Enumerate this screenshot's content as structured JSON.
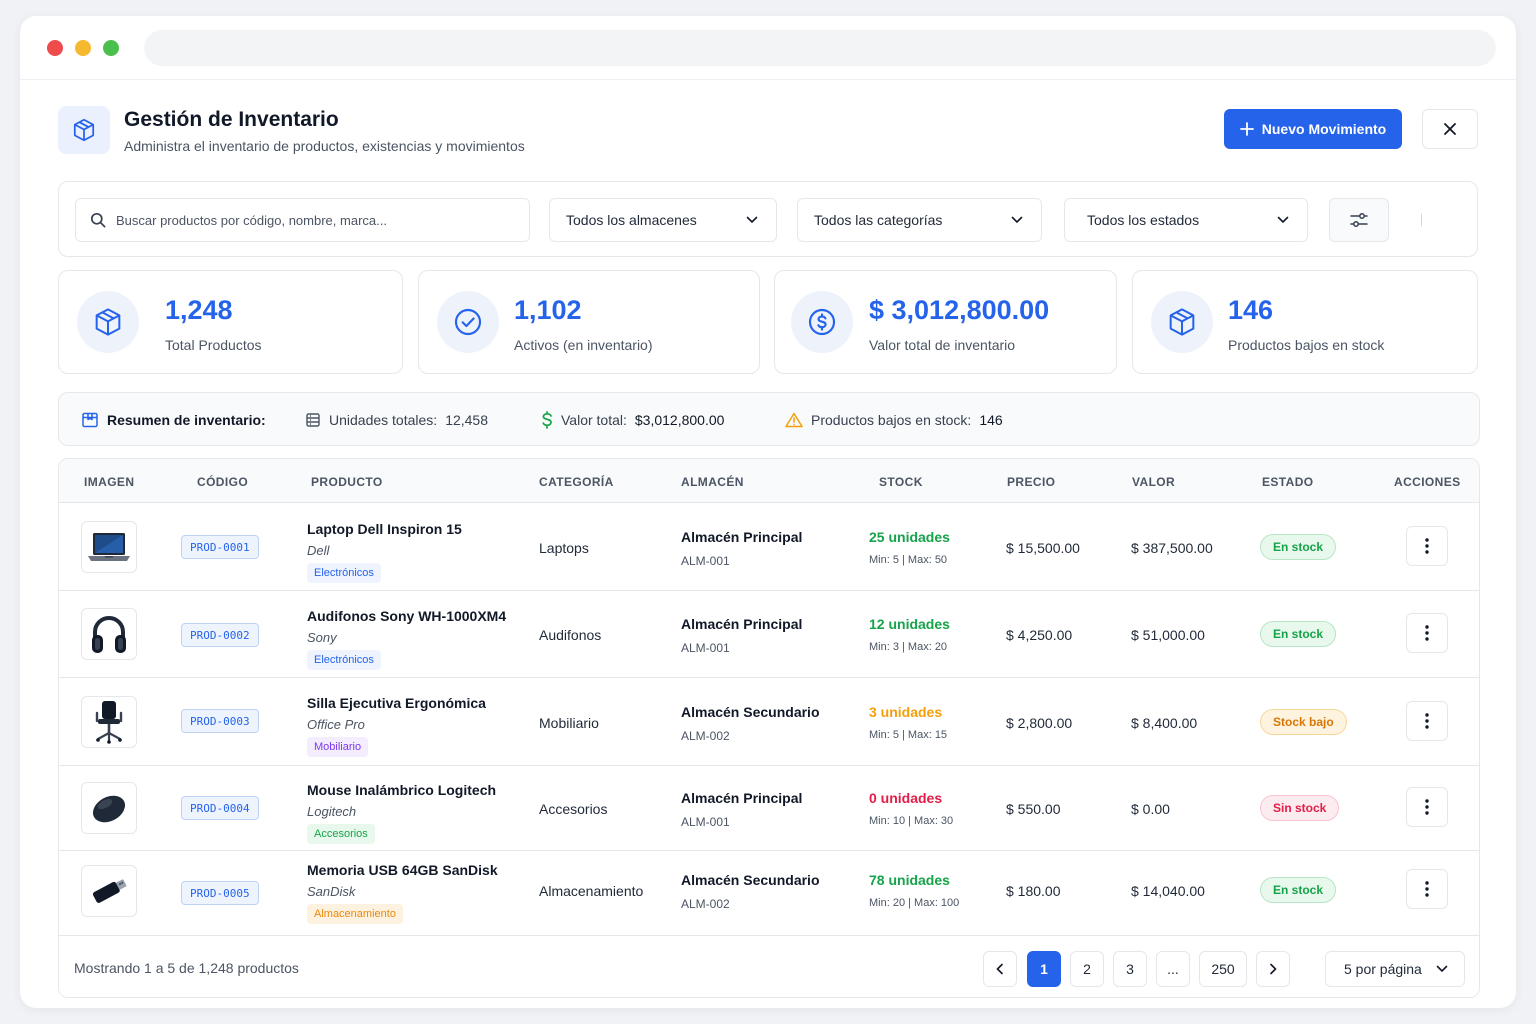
{
  "header": {
    "title": "Gestión de Inventario",
    "subtitle": "Administra el inventario de productos, existencias y movimientos",
    "new_button": "Nuevo Movimiento"
  },
  "filters": {
    "search_placeholder": "Buscar productos por código, nombre, marca...",
    "warehouse": "Todos los almacenes",
    "category": "Todos las categorías",
    "status": "Todos los estados"
  },
  "stats": [
    {
      "value": "1,248",
      "label": "Total Productos",
      "icon": "box-icon"
    },
    {
      "value": "1,102",
      "label": "Activos (en inventario)",
      "icon": "check-circle-icon"
    },
    {
      "value": "$ 3,012,800.00",
      "label": "Valor total de inventario",
      "icon": "dollar-circle-icon"
    },
    {
      "value": "146",
      "label": "Productos bajos en stock",
      "icon": "box-icon"
    }
  ],
  "summary": {
    "title": "Resumen de inventario:",
    "units_label": "Unidades totales:",
    "units_value": "12,458",
    "value_label": "Valor total:",
    "value_value": "$3,012,800.00",
    "low_label": "Productos bajos en stock:",
    "low_value": "146"
  },
  "table": {
    "headers": [
      "IMAGEN",
      "CÓDIGO",
      "PRODUCTO",
      "CATEGORÍA",
      "ALMACÉN",
      "STOCK",
      "PRECIO",
      "VALOR",
      "ESTADO",
      "ACCIONES"
    ],
    "rows": [
      {
        "image": "laptop",
        "code": "PROD-0001",
        "name": "Laptop Dell Inspiron 15",
        "brand": "Dell",
        "tag": "Electrónicos",
        "category": "Laptops",
        "warehouse": "Almacén Principal",
        "warehouse_code": "ALM-001",
        "stock": "25 unidades",
        "range": "Min: 5 | Max: 50",
        "price": "$ 15,500.00",
        "value": "$ 387,500.00",
        "status": "En stock"
      },
      {
        "image": "headphones",
        "code": "PROD-0002",
        "name": "Audifonos Sony WH-1000XM4",
        "brand": "Sony",
        "tag": "Electrónicos",
        "category": "Audifonos",
        "warehouse": "Almacén Principal",
        "warehouse_code": "ALM-001",
        "stock": "12 unidades",
        "range": "Min: 3 | Max: 20",
        "price": "$ 4,250.00",
        "value": "$ 51,000.00",
        "status": "En stock"
      },
      {
        "image": "chair",
        "code": "PROD-0003",
        "name": "Silla Ejecutiva Ergonómica",
        "brand": "Office Pro",
        "tag": "Mobiliario",
        "category": "Mobiliario",
        "warehouse": "Almacén Secundario",
        "warehouse_code": "ALM-002",
        "stock": "3 unidades",
        "range": "Min: 5 | Max: 15",
        "price": "$ 2,800.00",
        "value": "$ 8,400.00",
        "status": "Stock bajo"
      },
      {
        "image": "mouse",
        "code": "PROD-0004",
        "name": "Mouse Inalámbrico Logitech",
        "brand": "Logitech",
        "tag": "Accesorios",
        "category": "Accesorios",
        "warehouse": "Almacén Principal",
        "warehouse_code": "ALM-001",
        "stock": "0 unidades",
        "range": "Min: 10 | Max: 30",
        "price": "$ 550.00",
        "value": "$ 0.00",
        "status": "Sin stock"
      },
      {
        "image": "usb",
        "code": "PROD-0005",
        "name": "Memoria USB 64GB SanDisk",
        "brand": "SanDisk",
        "tag": "Almacenamiento",
        "category": "Almacenamiento",
        "warehouse": "Almacén Secundario",
        "warehouse_code": "ALM-002",
        "stock": "78 unidades",
        "range": "Min: 20 | Max: 100",
        "price": "$ 180.00",
        "value": "$ 14,040.00",
        "status": "En stock"
      }
    ]
  },
  "pagination": {
    "showing": "Mostrando 1 a 5 de 1,248 productos",
    "pages": [
      "1",
      "2",
      "3",
      "...",
      "250"
    ],
    "per_page": "5 por página"
  },
  "colors": {
    "accent": "#2563eb",
    "green": "#16a34a",
    "orange": "#f59e0b",
    "red": "#e11d48",
    "purple": "#7c3aed"
  }
}
